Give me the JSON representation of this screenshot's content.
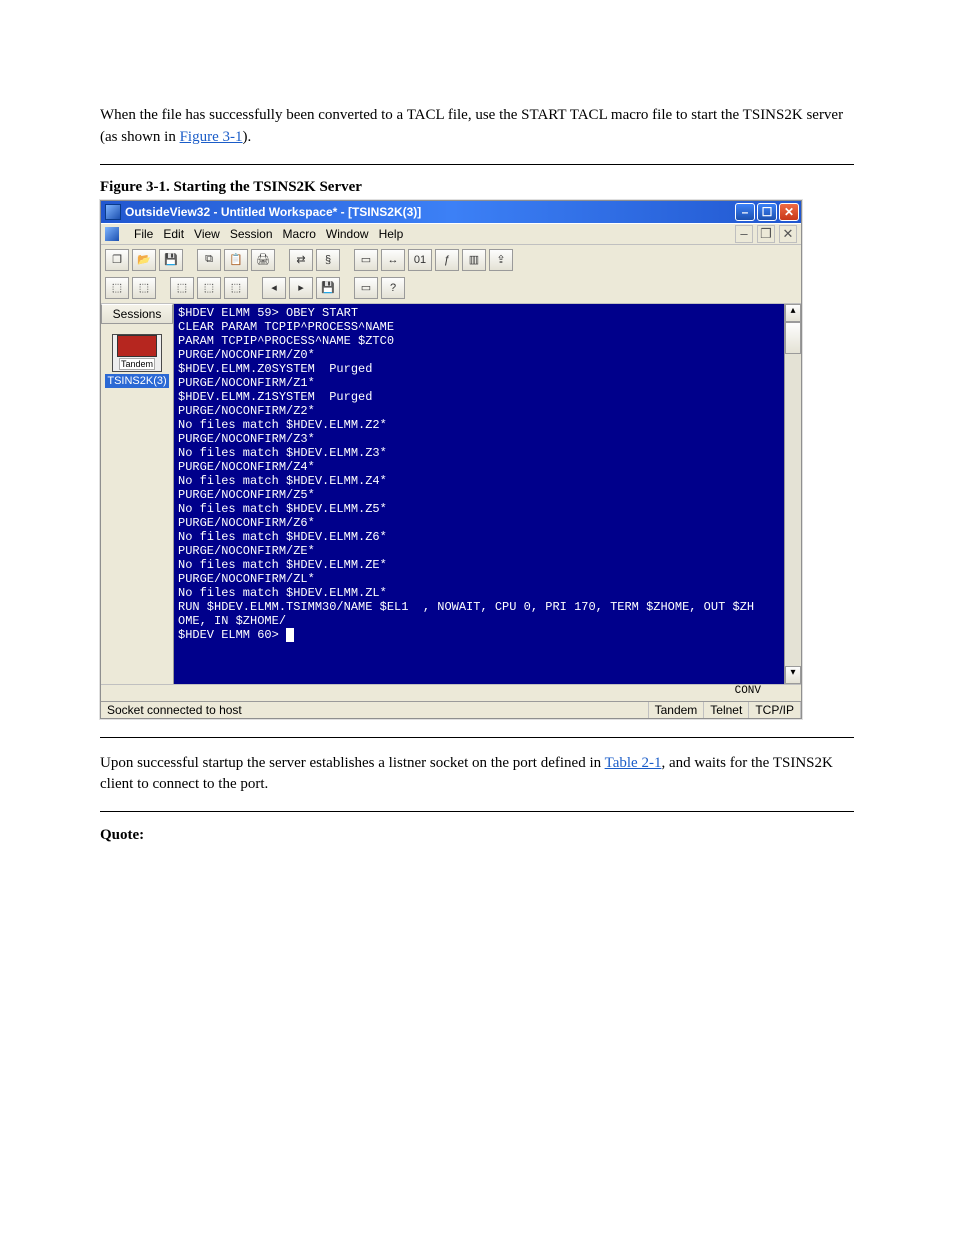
{
  "paragraph_before": {
    "pre": "When the file has successfully been converted to a TACL file, use the START TACL macro file to start the TSINS2K server (as shown in ",
    "fig_ref": "Figure 3-1",
    "post": ")."
  },
  "figure": {
    "label_prefix": "Figure 3-1.",
    "label_title": "Starting the TSINS2K Server"
  },
  "window": {
    "title": "OutsideView32 - Untitled Workspace* - [TSINS2K(3)]",
    "min_label": "–",
    "max_label": "☐",
    "close_label": "✕"
  },
  "menus": [
    "File",
    "Edit",
    "View",
    "Session",
    "Macro",
    "Window",
    "Help"
  ],
  "mdi": {
    "min": "–",
    "restore": "❐",
    "close": "✕"
  },
  "sessions": {
    "header": "Sessions",
    "icon_label": "Tandem",
    "selected": "TSINS2K(3)"
  },
  "terminal": {
    "lines": [
      "$HDEV ELMM 59> OBEY START",
      "CLEAR PARAM TCPIP^PROCESS^NAME",
      "PARAM TCPIP^PROCESS^NAME $ZTC0",
      "PURGE/NOCONFIRM/Z0*",
      "$HDEV.ELMM.Z0SYSTEM  Purged",
      "PURGE/NOCONFIRM/Z1*",
      "$HDEV.ELMM.Z1SYSTEM  Purged",
      "PURGE/NOCONFIRM/Z2*",
      "No files match $HDEV.ELMM.Z2*",
      "PURGE/NOCONFIRM/Z3*",
      "No files match $HDEV.ELMM.Z3*",
      "PURGE/NOCONFIRM/Z4*",
      "No files match $HDEV.ELMM.Z4*",
      "PURGE/NOCONFIRM/Z5*",
      "No files match $HDEV.ELMM.Z5*",
      "PURGE/NOCONFIRM/Z6*",
      "No files match $HDEV.ELMM.Z6*",
      "PURGE/NOCONFIRM/ZE*",
      "No files match $HDEV.ELMM.ZE*",
      "PURGE/NOCONFIRM/ZL*",
      "No files match $HDEV.ELMM.ZL*",
      "RUN $HDEV.ELMM.TSIMM30/NAME $EL1  , NOWAIT, CPU 0, PRI 170, TERM $ZHOME, OUT $ZH",
      "OME, IN $ZHOME/",
      "$HDEV ELMM 60> "
    ],
    "conv": "CONV"
  },
  "status": {
    "msg": "Socket connected to host",
    "term": "Tandem",
    "proto": "Telnet",
    "net": "TCP/IP"
  },
  "paragraph_after": {
    "pre": "Upon successful startup the server establishes a listner socket on the port defined in ",
    "table_ref": "Table 2-1",
    "post": ", and waits for the TSINS2K client to connect to the port."
  },
  "quote_label": "Quote:"
}
